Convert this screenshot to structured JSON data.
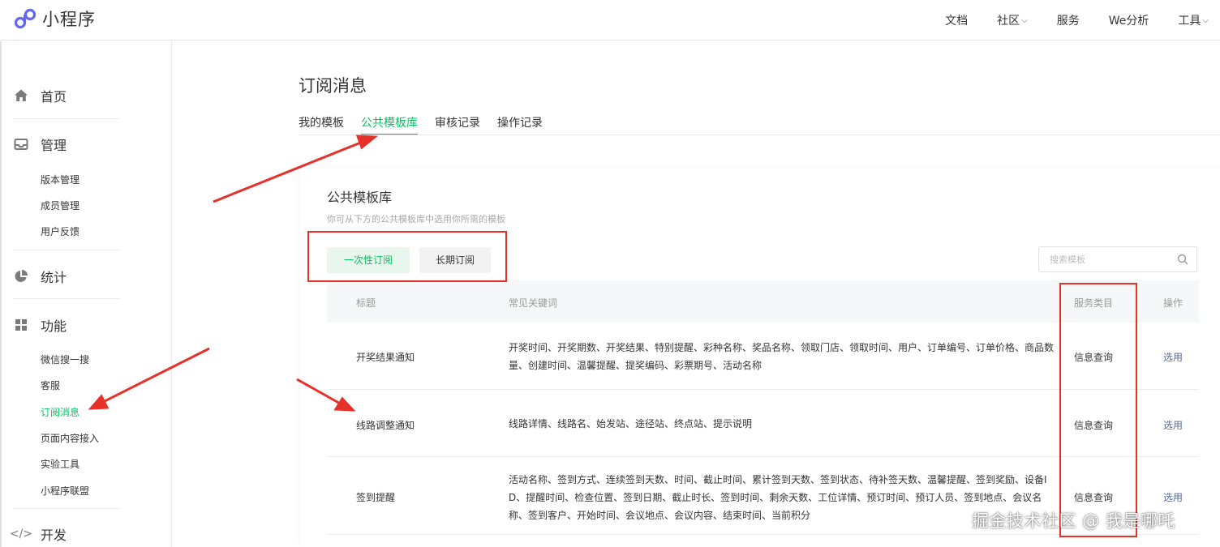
{
  "brand": {
    "name": "小程序",
    "logo_icon": "miniprogram-logo-icon",
    "color": "#6467f0"
  },
  "topnav": [
    {
      "label": "文档",
      "has_dropdown": false
    },
    {
      "label": "社区",
      "has_dropdown": true
    },
    {
      "label": "服务",
      "has_dropdown": false
    },
    {
      "label": "We分析",
      "has_dropdown": false
    },
    {
      "label": "工具",
      "has_dropdown": true
    }
  ],
  "sidebar": {
    "home": {
      "label": "首页",
      "icon": "home-icon"
    },
    "manage": {
      "label": "管理",
      "icon": "inbox-icon",
      "items": [
        "版本管理",
        "成员管理",
        "用户反馈"
      ]
    },
    "stats": {
      "label": "统计",
      "icon": "pie-chart-icon"
    },
    "features": {
      "label": "功能",
      "icon": "grid-icon",
      "items": [
        "微信搜一搜",
        "客服",
        "订阅消息",
        "页面内容接入",
        "实验工具",
        "小程序联盟"
      ],
      "active_item": "订阅消息"
    },
    "dev": {
      "label": "开发",
      "icon": "code-icon"
    }
  },
  "page": {
    "title": "订阅消息",
    "tabs": [
      "我的模板",
      "公共模板库",
      "审核记录",
      "操作记录"
    ],
    "active_tab": "公共模板库"
  },
  "panel": {
    "title": "公共模板库",
    "description": "你可从下方的公共模板库中选用你所需的模板",
    "segments": [
      "一次性订阅",
      "长期订阅"
    ],
    "active_segment": "一次性订阅",
    "search_placeholder": "搜索模板"
  },
  "table": {
    "headers": [
      "标题",
      "常见关键词",
      "服务类目",
      "操作"
    ],
    "rows": [
      {
        "title": "开奖结果通知",
        "keywords": "开奖时间、开奖期数、开奖结果、特别提醒、彩种名称、奖品名称、领取门店、领取时间、用户、订单编号、订单价格、商品数量、创建时间、温馨提醒、提奖编码、彩票期号、活动名称",
        "category": "信息查询",
        "action": "选用"
      },
      {
        "title": "线路调整通知",
        "keywords": "线路详情、线路名、始发站、途径站、终点站、提示说明",
        "category": "信息查询",
        "action": "选用"
      },
      {
        "title": "签到提醒",
        "keywords": "活动名称、签到方式、连续签到天数、时间、截止时间、累计签到天数、签到状态、待补签天数、温馨提醒、签到奖励、设备ID、提醒时间、检查位置、签到日期、截止时长、签到时间、剩余天数、工位详情、预订时间、预订人员、签到地点、会议名称、签到客户、开始时间、会议地点、会议内容、结束时间、当前积分",
        "category": "信息查询",
        "action": "选用"
      }
    ]
  },
  "annotation_color": "#e5312a",
  "accent_color": "#07c160",
  "link_color": "#576b95",
  "watermark": "掘金技术社区 @ 我是哪吒"
}
